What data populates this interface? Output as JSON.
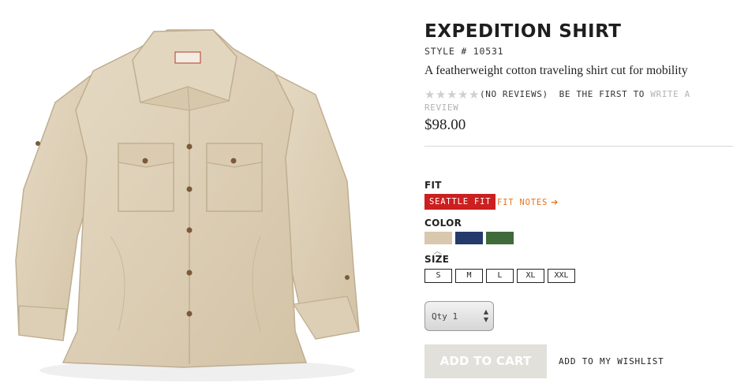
{
  "product": {
    "title": "EXPEDITION SHIRT",
    "style_number": "STYLE # 10531",
    "tagline": "A featherweight cotton traveling shirt cut for mobility",
    "price": "$98.00",
    "image_alt": "shirt-photo"
  },
  "reviews": {
    "rating": 0,
    "max_rating": 5,
    "count_text": "(NO REVIEWS)",
    "prompt": "BE THE FIRST TO",
    "link": "WRITE A REVIEW"
  },
  "fit": {
    "label": "FIT",
    "selected": "SEATTLE FIT",
    "notes_label": "FIT NOTES",
    "notes_icon": "arrow-right-icon",
    "badge_color": "#cc1f1f",
    "notes_color": "#e8731c"
  },
  "color": {
    "label": "COLOR",
    "swatches": [
      {
        "name": "khaki",
        "hex": "#d8c8ae",
        "selected": true
      },
      {
        "name": "navy",
        "hex": "#233a6a",
        "selected": false
      },
      {
        "name": "green",
        "hex": "#3f6a3a",
        "selected": false
      }
    ]
  },
  "size": {
    "label": "SIZE",
    "options": [
      "S",
      "M",
      "L",
      "XL",
      "XXL"
    ]
  },
  "quantity": {
    "label": "Qty 1"
  },
  "actions": {
    "add_to_cart": "ADD TO CART",
    "wishlist": "ADD TO MY WISHLIST"
  }
}
